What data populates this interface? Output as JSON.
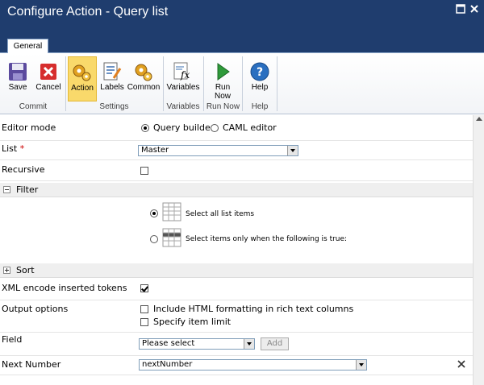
{
  "window": {
    "title": "Configure Action - Query list"
  },
  "tabs": [
    {
      "label": "General"
    }
  ],
  "ribbon": {
    "buttons": [
      {
        "label": "Save",
        "icon": "save-icon"
      },
      {
        "label": "Cancel",
        "icon": "cancel-icon"
      },
      {
        "label": "Action",
        "icon": "action-icon"
      },
      {
        "label": "Labels",
        "icon": "labels-icon"
      },
      {
        "label": "Common",
        "icon": "common-icon"
      },
      {
        "label": "Variables",
        "icon": "variables-icon"
      },
      {
        "label": "Run Now",
        "icon": "run-icon"
      },
      {
        "label": "Help",
        "icon": "help-icon"
      }
    ],
    "groups": [
      "Commit",
      "Settings",
      "Variables",
      "Run Now",
      "Help"
    ]
  },
  "form": {
    "editor_mode": {
      "label": "Editor mode",
      "options": [
        "Query builder",
        "CAML editor"
      ],
      "selected": "Query builder"
    },
    "list": {
      "label": "List",
      "required_mark": "*",
      "value": "Master"
    },
    "recursive": {
      "label": "Recursive",
      "checked": false
    },
    "filter": {
      "label": "Filter",
      "option_all": "Select all list items",
      "option_when": "Select items only when the following is true:",
      "selected": "all"
    },
    "sort": {
      "label": "Sort"
    },
    "xml_encode": {
      "label": "XML encode inserted tokens",
      "checked": true
    },
    "output_options": {
      "label": "Output options",
      "opt1": "Include HTML formatting in rich text columns",
      "opt2": "Specify item limit"
    },
    "field": {
      "label": "Field",
      "value": "Please select",
      "add_label": "Add"
    },
    "next_number": {
      "label": "Next Number",
      "value": "nextNumber"
    }
  },
  "colors": {
    "titlebar": "#1f3d6e",
    "active_button": "#f9d96b"
  }
}
